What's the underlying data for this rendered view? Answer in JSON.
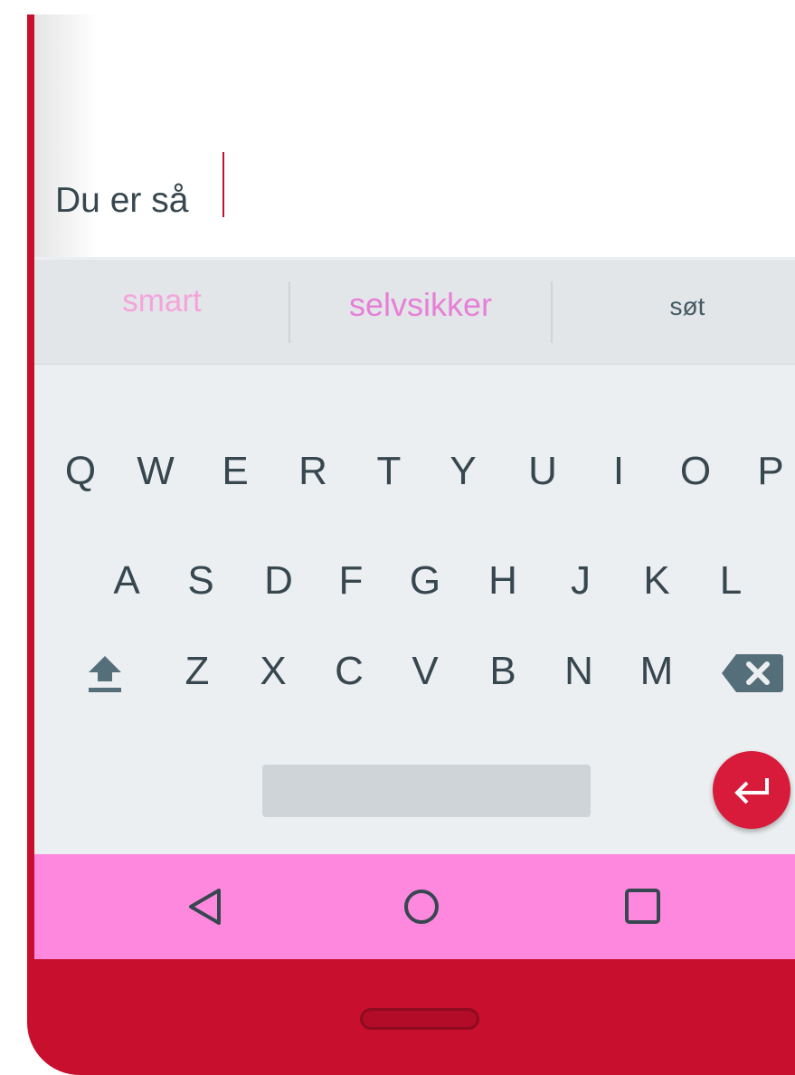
{
  "input": {
    "text": "Du er så"
  },
  "suggestions": [
    {
      "label": "smart"
    },
    {
      "label": "selvsikker"
    },
    {
      "label": "søt"
    }
  ],
  "keyboard": {
    "row1": [
      "Q",
      "W",
      "E",
      "R",
      "T",
      "Y",
      "U",
      "I",
      "O",
      "P"
    ],
    "row2": [
      "A",
      "S",
      "D",
      "F",
      "G",
      "H",
      "J",
      "K",
      "L"
    ],
    "row3": [
      "Z",
      "X",
      "C",
      "V",
      "B",
      "N",
      "M"
    ],
    "icons": {
      "shift": "shift-arrow-icon",
      "backspace": "backspace-icon",
      "enter": "enter-return-icon"
    }
  },
  "navbar": {
    "icons": [
      "back-triangle-icon",
      "home-circle-icon",
      "recents-square-icon"
    ]
  },
  "colors": {
    "device_frame": "#c8102e",
    "caret": "#c8102e",
    "enter_button": "#d81b3a",
    "navbar": "#ff88df",
    "suggestion_1": "#f5a3dc",
    "suggestion_2": "#e77fd8",
    "key_text": "#37474f",
    "keyboard_bg": "#eceff1"
  }
}
